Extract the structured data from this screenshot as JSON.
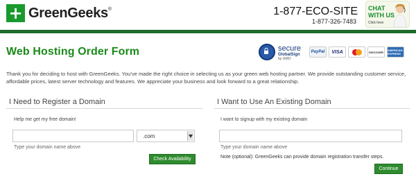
{
  "header": {
    "logo_mark": "+",
    "logo_text": "GreenGeeks",
    "logo_reg": "®",
    "phone_main": "1-877-ECO-SITE",
    "phone_sub": "1-877-326-7483",
    "chat_line1": "CHAT",
    "chat_line2": "WITH US",
    "chat_line3": "Click here"
  },
  "page": {
    "title": "Web Hosting Order Form",
    "intro": "Thank you for deciding to host with GreenGeeks. You've made the right choice in selecting us as your green web hosting partner. We provide outstanding customer service, affordable prices, latest server technology and features. We appreciate your business and look forward to a great relationship."
  },
  "badges": {
    "secure_l1": "secure",
    "secure_l2": "GlobalSign",
    "secure_l3": "by GMO",
    "paypal": "PayPal",
    "visa": "VISA",
    "discover": "DISCOVER",
    "amex": "AMERICAN EXPRESS"
  },
  "register": {
    "heading": "I Need to Register a Domain",
    "help": "Help me get my free domain!",
    "input_value": "",
    "tld_selected": ".com",
    "hint": "Type your domain name above",
    "button": "Check Availability"
  },
  "existing": {
    "heading": "I Want to Use An Existing Domain",
    "help": "I want to signup with my existing domain",
    "input_value": "",
    "hint": "Type your domain name above",
    "note": "Note (optional): GreenGeeks can provide domain registration transfer steps.",
    "button": "Continue"
  },
  "colors": {
    "brand_green": "#1a9a2e",
    "header_bar": "#1e6b2c",
    "title_green": "#1a8a1a",
    "button_green": "#2e8b2e"
  },
  "icons": {
    "logo": "plus-square-icon",
    "secure": "padlock-icon",
    "select": "chevron-down-icon"
  }
}
